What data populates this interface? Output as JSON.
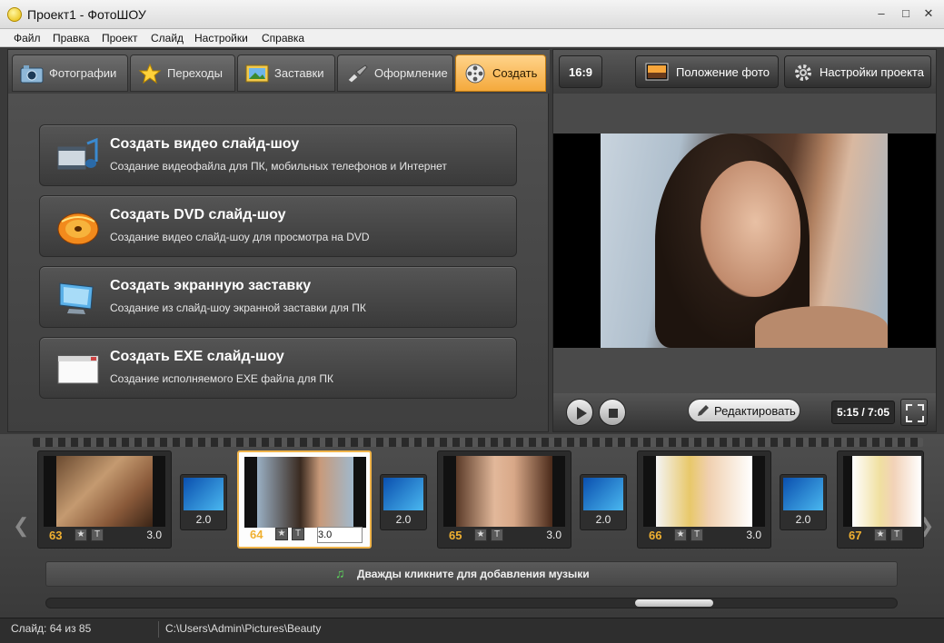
{
  "window": {
    "title": "Проект1 - ФотоШОУ"
  },
  "menu": [
    "Файл",
    "Правка",
    "Проект",
    "Слайд",
    "Настройки",
    "Справка"
  ],
  "tabs": [
    {
      "label": "Фотографии",
      "icon": "camera-icon"
    },
    {
      "label": "Переходы",
      "icon": "star-icon"
    },
    {
      "label": "Заставки",
      "icon": "picture-icon"
    },
    {
      "label": "Оформление",
      "icon": "brush-icon"
    },
    {
      "label": "Создать",
      "icon": "film-reel-icon",
      "active": true
    }
  ],
  "actions": [
    {
      "title": "Создать видео слайд-шоу",
      "desc": "Создание видеофайла для ПК, мобильных телефонов и Интернет",
      "icon": "video-film-icon"
    },
    {
      "title": "Создать DVD слайд-шоу",
      "desc": "Создание видео слайд-шоу для просмотра на DVD",
      "icon": "dvd-disc-icon"
    },
    {
      "title": "Создать экранную заставку",
      "desc": "Создание из слайд-шоу экранной заставки для ПК",
      "icon": "monitor-icon"
    },
    {
      "title": "Создать EXE слайд-шоу",
      "desc": "Создание исполняемого EXE файла для ПК",
      "icon": "window-icon"
    }
  ],
  "preview": {
    "aspect": "16:9",
    "photo_position": "Положение фото",
    "project_settings": "Настройки проекта",
    "edit": "Редактировать",
    "time": "5:15 / 7:05"
  },
  "slides": [
    {
      "num": "63",
      "duration": "3.0"
    },
    {
      "num": "64",
      "duration": "3.0",
      "selected": true
    },
    {
      "num": "65",
      "duration": "3.0"
    },
    {
      "num": "66",
      "duration": "3.0"
    },
    {
      "num": "67",
      "duration": ""
    }
  ],
  "transitions": [
    "2.0",
    "2.0",
    "2.0",
    "2.0"
  ],
  "music": {
    "label": "Дважды кликните для добавления музыки"
  },
  "status": {
    "slide": "Слайд: 64 из 85",
    "path": "C:\\Users\\Admin\\Pictures\\Beauty"
  },
  "colors": {
    "accent": "#f4a93c",
    "slide_number": "#f0b030"
  }
}
